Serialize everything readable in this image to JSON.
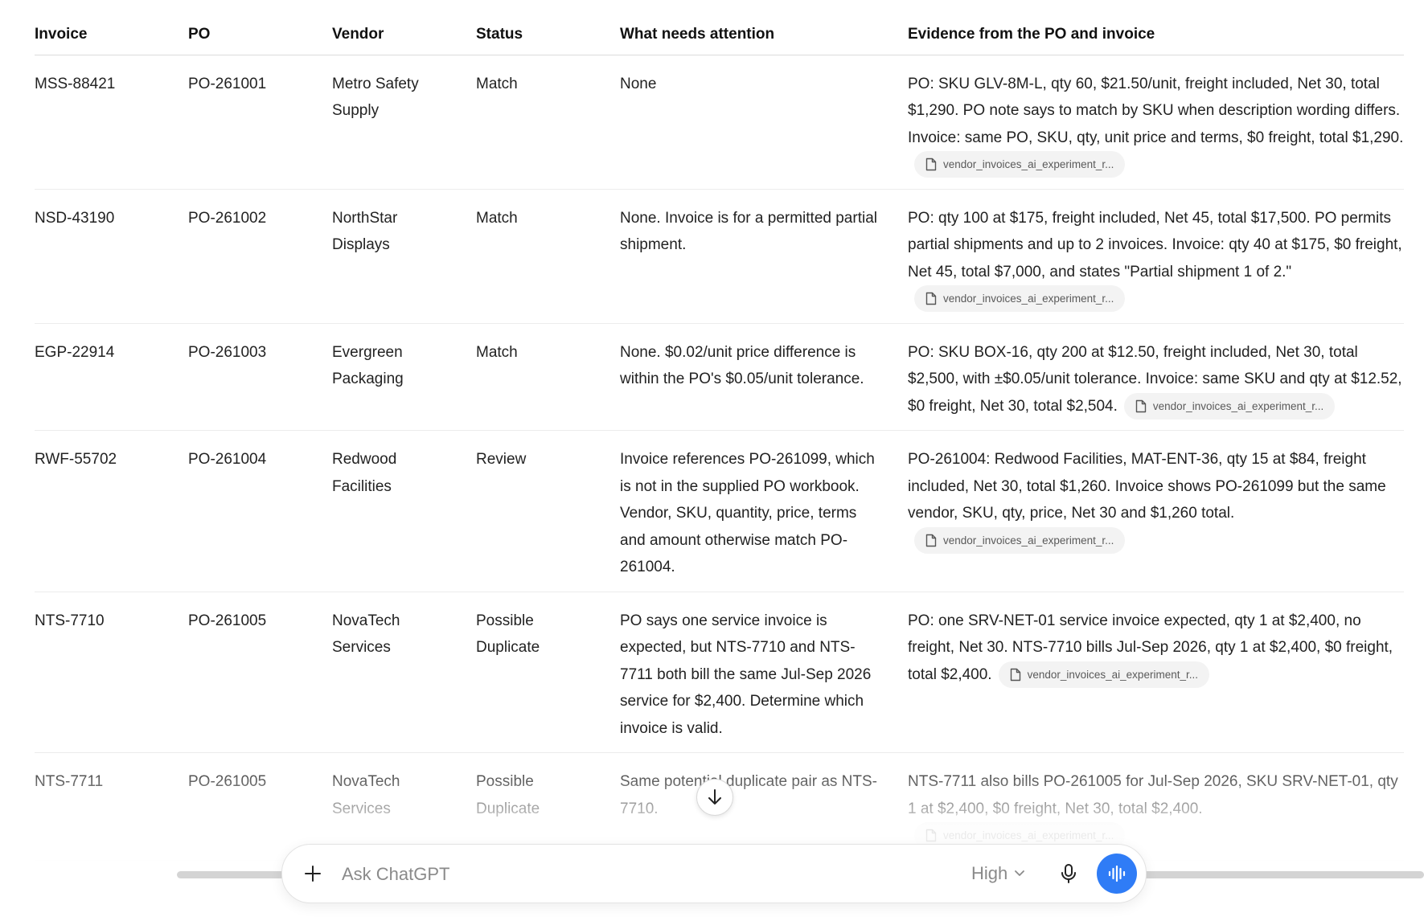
{
  "table": {
    "headers": [
      "Invoice",
      "PO",
      "Vendor",
      "Status",
      "What needs attention",
      "Evidence from the PO and invoice"
    ],
    "rows": [
      {
        "invoice": "MSS-88421",
        "po": "PO-261001",
        "vendor": "Metro Safety Supply",
        "status": "Match",
        "attention": "None",
        "evidence": "PO: SKU GLV-8M-L, qty 60, $21.50/unit, freight included, Net 30, total $1,290. PO note says to match by SKU when description wording differs. Invoice: same PO, SKU, qty, unit price and terms, $0 freight, total $1,290.",
        "citation": "vendor_invoices_ai_experiment_r..."
      },
      {
        "invoice": "NSD-43190",
        "po": "PO-261002",
        "vendor": "NorthStar Displays",
        "status": "Match",
        "attention": "None. Invoice is for a permitted partial shipment.",
        "evidence": "PO: qty 100 at $175, freight included, Net 45, total $17,500. PO permits partial shipments and up to 2 invoices. Invoice: qty 40 at $175, $0 freight, Net 45, total $7,000, and states \"Partial shipment 1 of 2.\"",
        "citation": "vendor_invoices_ai_experiment_r..."
      },
      {
        "invoice": "EGP-22914",
        "po": "PO-261003",
        "vendor": "Evergreen Packaging",
        "status": "Match",
        "attention": "None. $0.02/unit price difference is within the PO's $0.05/unit tolerance.",
        "evidence": "PO: SKU BOX-16, qty 200 at $12.50, freight included, Net 30, total $2,500, with ±$0.05/unit tolerance. Invoice: same SKU and qty at $12.52, $0 freight, Net 30, total $2,504.",
        "citation": "vendor_invoices_ai_experiment_r..."
      },
      {
        "invoice": "RWF-55702",
        "po": "PO-261004",
        "vendor": "Redwood Facilities",
        "status": "Review",
        "attention": "Invoice references PO-261099, which is not in the supplied PO workbook. Vendor, SKU, quantity, price, terms and amount otherwise match PO-261004.",
        "evidence": "PO-261004: Redwood Facilities, MAT-ENT-36, qty 15 at $84, freight included, Net 30, total $1,260. Invoice shows PO-261099 but the same vendor, SKU, qty, price, Net 30 and $1,260 total.",
        "citation": "vendor_invoices_ai_experiment_r..."
      },
      {
        "invoice": "NTS-7710",
        "po": "PO-261005",
        "vendor": "NovaTech Services",
        "status": "Possible Duplicate",
        "attention": "PO says one service invoice is expected, but NTS-7710 and NTS-7711 both bill the same Jul-Sep 2026 service for $2,400. Determine which invoice is valid.",
        "evidence": "PO: one SRV-NET-01 service invoice expected, qty 1 at $2,400, no freight, Net 30. NTS-7710 bills Jul-Sep 2026, qty 1 at $2,400, $0 freight, total $2,400.",
        "citation": "vendor_invoices_ai_experiment_r..."
      },
      {
        "invoice": "NTS-7711",
        "po": "PO-261005",
        "vendor": "NovaTech Services",
        "status": "Possible Duplicate",
        "attention": "Same potential duplicate pair as NTS-7710.",
        "evidence": "NTS-7711 also bills PO-261005 for Jul-Sep 2026, SKU SRV-NET-01, qty 1 at $2,400, $0 freight, Net 30, total $2,400.",
        "citation": "vendor_invoices_ai_experiment_r..."
      }
    ]
  },
  "composer": {
    "placeholder": "Ask ChatGPT",
    "model_label": "High"
  },
  "icons": {
    "citation": "document-icon",
    "scroll": "arrow-down-icon",
    "attach": "plus-icon",
    "model": "chevron-down-icon",
    "dictate": "microphone-icon",
    "voice": "voice-waveform-icon"
  },
  "colors": {
    "voice_button": "#2f7cf6"
  }
}
